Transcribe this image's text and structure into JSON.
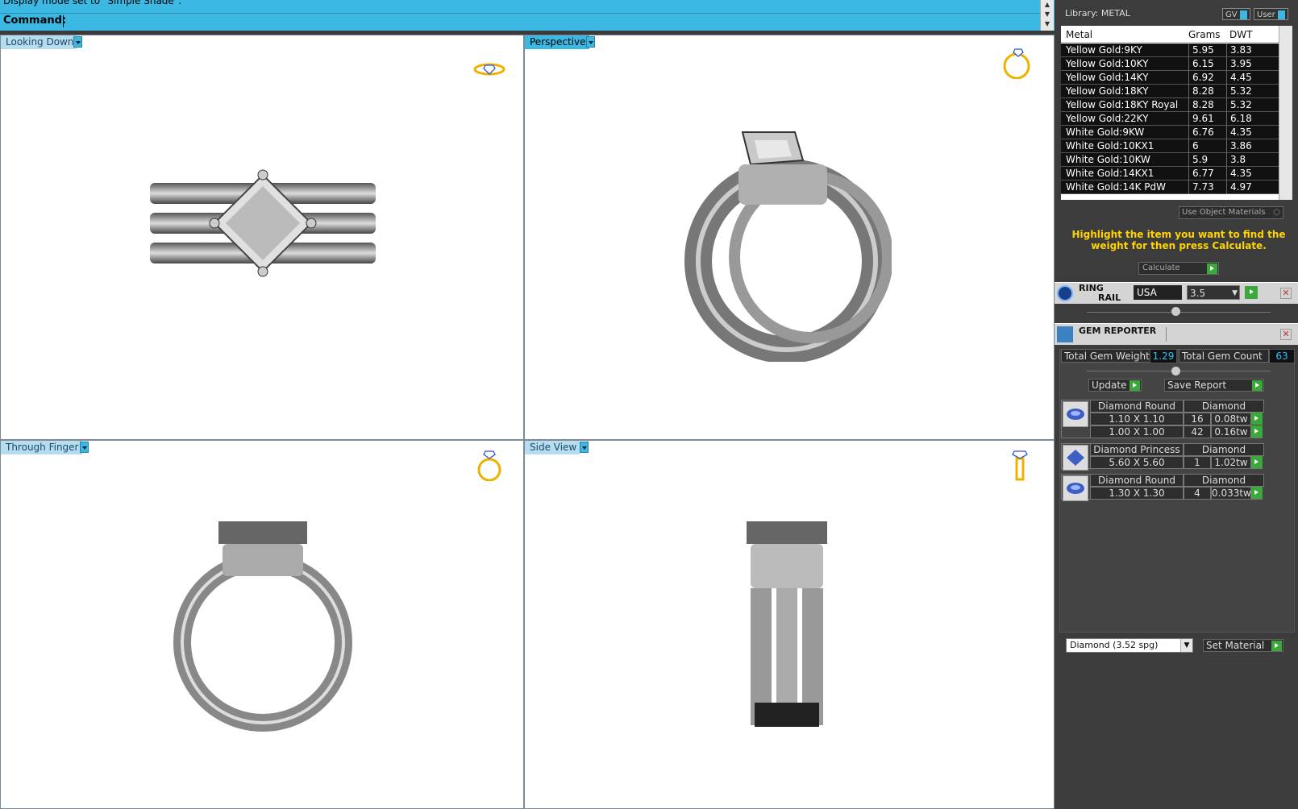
{
  "command_bar": {
    "status_line": "Display mode set to \"Simple Shade\".",
    "command_label": "Command:"
  },
  "viewports": [
    {
      "label": "Looking Down",
      "active": false
    },
    {
      "label": "Perspective",
      "active": true
    },
    {
      "label": "Through Finger",
      "active": false
    },
    {
      "label": "Side View",
      "active": false
    }
  ],
  "panel": {
    "library_label": "Library: METAL",
    "toggle_gv": "GV",
    "toggle_user": "User",
    "metal_table": {
      "headers": [
        "Metal",
        "Grams",
        "DWT"
      ],
      "rows": [
        [
          "Yellow Gold:9KY",
          "5.95",
          "3.83"
        ],
        [
          "Yellow Gold:10KY",
          "6.15",
          "3.95"
        ],
        [
          "Yellow Gold:14KY",
          "6.92",
          "4.45"
        ],
        [
          "Yellow Gold:18KY",
          "8.28",
          "5.32"
        ],
        [
          "Yellow Gold:18KY Royal",
          "8.28",
          "5.32"
        ],
        [
          "Yellow Gold:22KY",
          "9.61",
          "6.18"
        ],
        [
          "White Gold:9KW",
          "6.76",
          "4.35"
        ],
        [
          "White Gold:10KX1",
          "6",
          "3.86"
        ],
        [
          "White Gold:10KW",
          "5.9",
          "3.8"
        ],
        [
          "White Gold:14KX1",
          "6.77",
          "4.35"
        ],
        [
          "White Gold:14K PdW",
          "7.73",
          "4.97"
        ]
      ]
    },
    "use_object_materials": "Use Object Materials",
    "hint": "Highlight the item you want to find the weight for then press Calculate.",
    "calculate": "Calculate",
    "ring_rail": {
      "title_line1": "RING",
      "title_line2": "RAIL",
      "standard": "USA",
      "size": "3.5"
    },
    "gem_reporter": {
      "title": "GEM REPORTER",
      "total_weight_label": "Total Gem Weight",
      "total_weight": "1.29",
      "total_count_label": "Total Gem Count",
      "total_count": "63",
      "update": "Update",
      "save_report": "Save Report",
      "groups": [
        {
          "shape": "Diamond Round",
          "material": "Diamond",
          "rows": [
            {
              "size": "1.10 X 1.10",
              "count": "16",
              "weight": "0.08tw"
            },
            {
              "size": "1.00 X 1.00",
              "count": "42",
              "weight": "0.16tw"
            }
          ]
        },
        {
          "shape": "Diamond Princess",
          "material": "Diamond",
          "rows": [
            {
              "size": "5.60 X 5.60",
              "count": "1",
              "weight": "1.02tw"
            }
          ]
        },
        {
          "shape": "Diamond Round",
          "material": "Diamond",
          "rows": [
            {
              "size": "1.30 X 1.30",
              "count": "4",
              "weight": "0.033tw"
            }
          ]
        }
      ],
      "material_select": "Diamond    (3.52 spg)",
      "set_material": "Set Material"
    },
    "colors": {
      "accent": "#3bb9e3",
      "hint": "#ffd400",
      "value": "#29c4ff",
      "go": "#3aa83a"
    }
  }
}
